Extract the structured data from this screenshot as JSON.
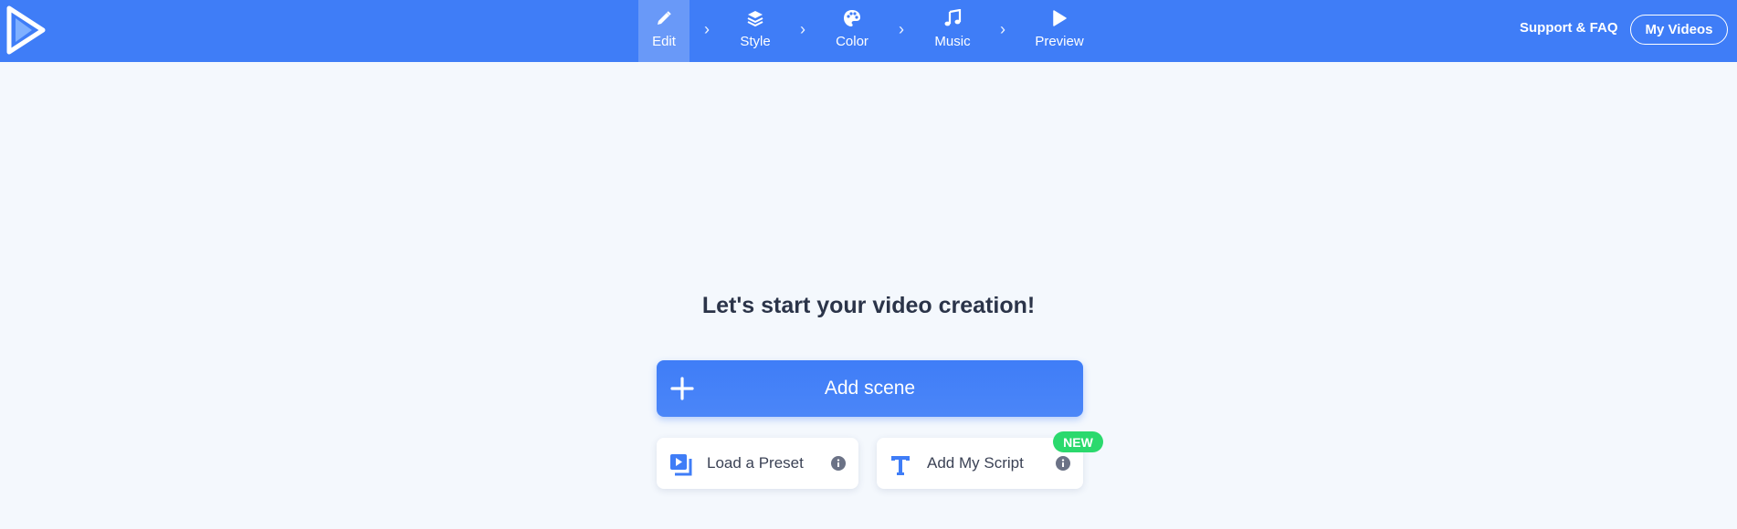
{
  "nav": {
    "steps": [
      {
        "label": "Edit",
        "icon": "pencil-icon",
        "active": true
      },
      {
        "label": "Style",
        "icon": "layers-icon",
        "active": false
      },
      {
        "label": "Color",
        "icon": "palette-icon",
        "active": false
      },
      {
        "label": "Music",
        "icon": "music-note-icon",
        "active": false
      },
      {
        "label": "Preview",
        "icon": "play-icon",
        "active": false
      }
    ],
    "support_label": "Support & FAQ",
    "my_videos_label": "My Videos"
  },
  "main": {
    "headline": "Let's start your video creation!",
    "add_scene_label": "Add scene",
    "load_preset_label": "Load a Preset",
    "add_script_label": "Add My Script",
    "new_badge": "NEW"
  },
  "colors": {
    "brand_blue": "#3f7df7",
    "background": "#f4f8fd",
    "new_badge_green": "#2bd96d",
    "heading_text": "#2b3449"
  }
}
